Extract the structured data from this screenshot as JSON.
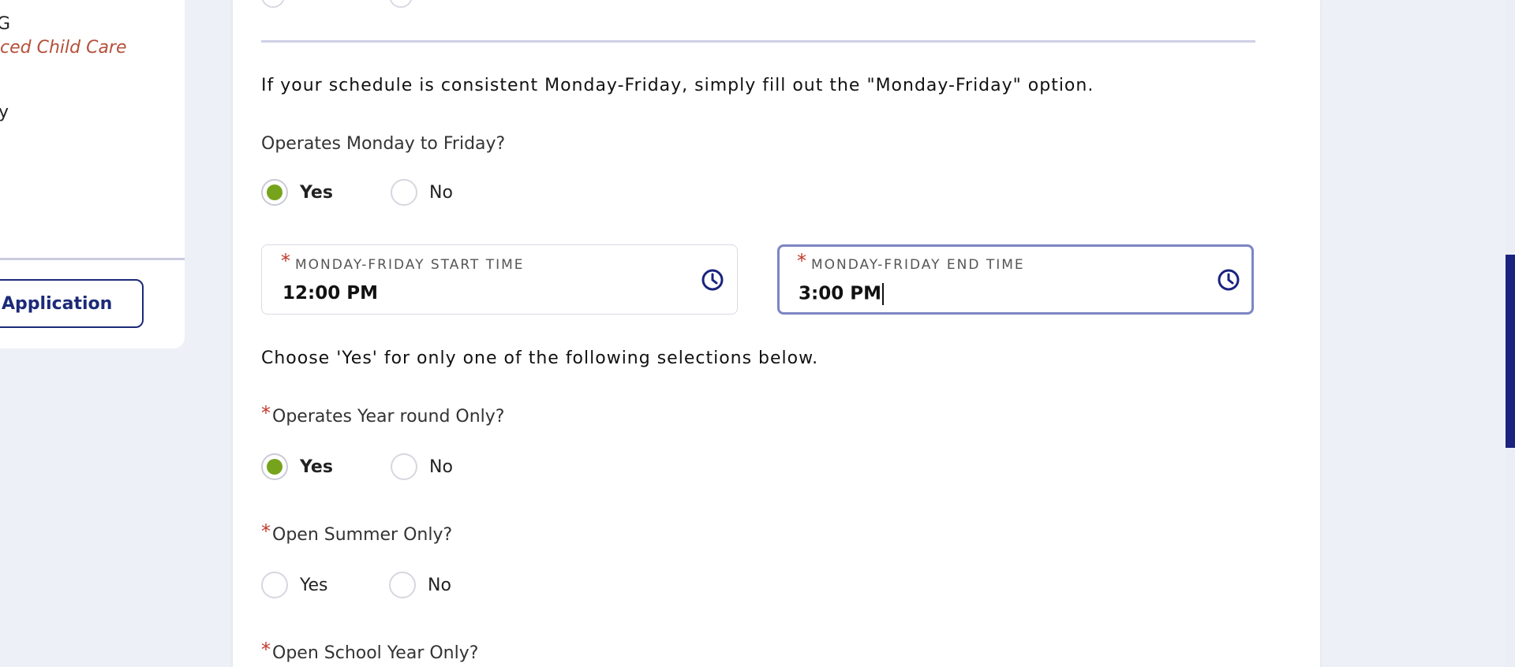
{
  "sidebar": {
    "partial_g": "G",
    "partial_child_care": "ced Child Care",
    "partial_y": "y",
    "application_button": "Application"
  },
  "form": {
    "schedule_instruction": "If your schedule is consistent Monday-Friday, simply fill out the \"Monday-Friday\" option.",
    "q_monfri": {
      "label": "Operates Monday to Friday?",
      "options": [
        "Yes",
        "No"
      ],
      "selected": "Yes"
    },
    "start_time": {
      "required_mark": "*",
      "label": "MONDAY-FRIDAY START TIME",
      "value": "12:00 PM"
    },
    "end_time": {
      "required_mark": "*",
      "label": "MONDAY-FRIDAY END TIME",
      "value": "3:00 PM"
    },
    "choose_instruction": "Choose 'Yes' for only one of the following selections below.",
    "q_year_round": {
      "required_mark": "*",
      "label": "Operates Year round Only?",
      "options": [
        "Yes",
        "No"
      ],
      "selected": "Yes"
    },
    "q_summer": {
      "required_mark": "*",
      "label": "Open Summer Only?",
      "options": [
        "Yes",
        "No"
      ],
      "selected": ""
    },
    "q_school_year": {
      "required_mark": "*",
      "label": "Open School Year Only?"
    }
  },
  "icons": {
    "clock": "clock-icon",
    "radio_selected_color": "#76a31c",
    "accent": "#1a237e",
    "required_color": "#c0392b"
  }
}
